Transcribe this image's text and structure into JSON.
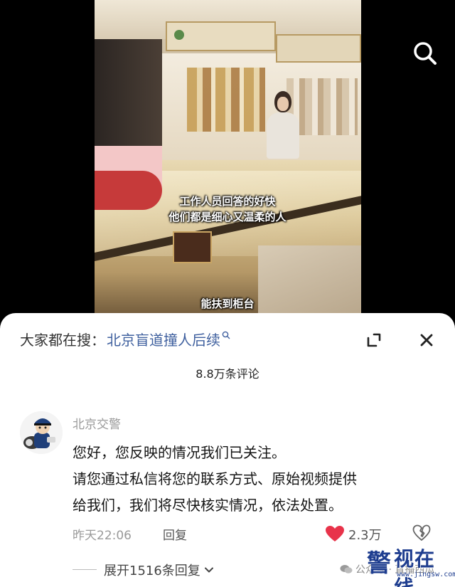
{
  "video": {
    "caption_line1": "工作人员回答的好快",
    "caption_line2": "他们都是细心又温柔的人",
    "caption_line3": "能扶到柜台",
    "search_icon": "search-icon"
  },
  "sheet": {
    "search_prefix": "大家都在搜：",
    "search_term": "北京盲道撞人后续",
    "expand_icon": "expand-icon",
    "close_icon": "close-icon",
    "comment_count": "8.8万条评论"
  },
  "comment": {
    "author": "北京交警",
    "lines": [
      "您好，您反映的情况我们已关注。",
      "请您通过私信将您的联系方式、原始视频提供",
      "给我们，我们将尽快核实情况，依法处置。"
    ],
    "time": "昨天22:06",
    "reply_label": "回复",
    "likes": "2.3万",
    "expand_replies": "展开1516条回复"
  },
  "watermark": {
    "wechat": "公众号 · 直播西瓜",
    "brand_mark": "警",
    "brand": "视在线",
    "url": "www.jingsw.com"
  },
  "colors": {
    "accent_link": "#3e5f9e",
    "like_red": "#e8334a",
    "brand_blue": "#1e3d8f"
  }
}
